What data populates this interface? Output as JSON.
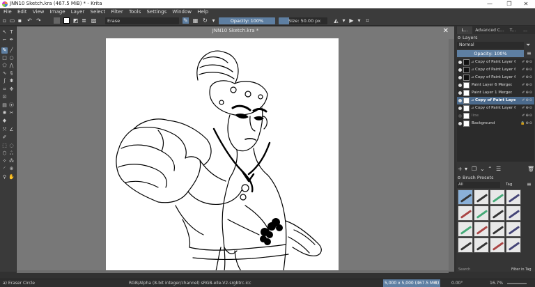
{
  "window": {
    "title": "JNN10 Sketch.kra (467.5 MiB)  * - Krita",
    "minimize": "—",
    "maximize": "❐",
    "close": "✕"
  },
  "menu": [
    "File",
    "Edit",
    "View",
    "Image",
    "Layer",
    "Select",
    "Filter",
    "Tools",
    "Settings",
    "Window",
    "Help"
  ],
  "toolbar": {
    "brush_preset": "Erase",
    "opacity_label": "Opacity:  100%",
    "opacity_value": 1.0,
    "size_label": "Size: 50.00 px",
    "size_fraction": 0.22,
    "accent_color": "#5e7fa2"
  },
  "canvas": {
    "document_title": "JNN10 Sketch.kra *",
    "close_icon": "✕"
  },
  "dock": {
    "tabs": [
      "L...",
      "Advanced C...",
      "T...",
      "..."
    ],
    "layers_title": "Layers",
    "blend_mode": "Normal",
    "layer_opacity": "Opacity:  100%",
    "layers": [
      {
        "name": "Copy of Paint Layer 6 ...",
        "thumb": "black",
        "selected": false
      },
      {
        "name": "Copy of Paint Layer 6 ...",
        "thumb": "black",
        "selected": false
      },
      {
        "name": "Copy of Paint Layer 6 ...",
        "thumb": "black",
        "selected": false
      },
      {
        "name": "Paint Layer 6 Merged",
        "thumb": "white",
        "selected": false
      },
      {
        "name": "Paint Layer 1 Merged",
        "thumb": "white",
        "selected": false
      },
      {
        "name": "Copy of Paint Layer ...",
        "thumb": "white",
        "selected": true
      },
      {
        "name": "Copy of Paint Layer 6 ...",
        "thumb": "white",
        "selected": false
      },
      {
        "name": "line",
        "thumb": "white",
        "selected": false,
        "dim": true
      },
      {
        "name": "Background",
        "thumb": "white",
        "selected": false
      }
    ],
    "brush_presets_title": "Brush Presets",
    "brush_filter": "All",
    "tag_label": "Tag",
    "search_placeholder": "Search",
    "filter_in_tag": "Filter in Tag"
  },
  "status": {
    "tool": "a) Eraser Circle",
    "color_space": "RGB/Alpha (8-bit integer/channel)  sRGB-elle-V2-srgbtrc.icc",
    "memory": "5,000 x 5,000 (467.5 MiB)",
    "rotation": "0.00°",
    "zoom": "16.7%"
  }
}
